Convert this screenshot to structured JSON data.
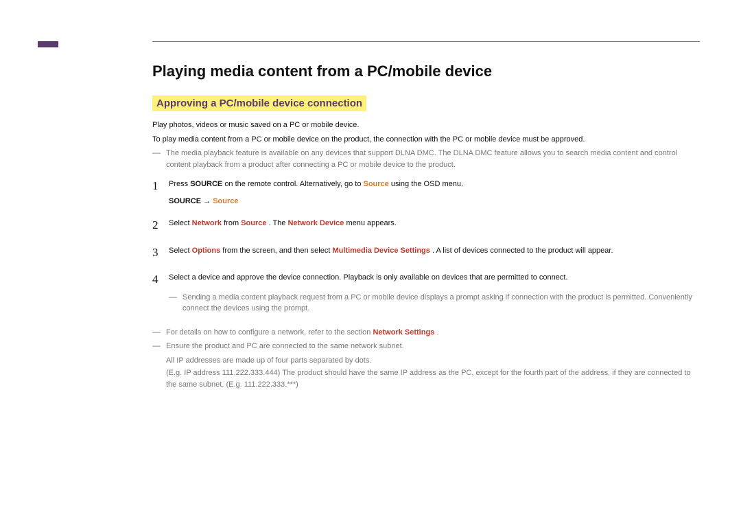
{
  "title": "Playing media content from a PC/mobile device",
  "section_heading": "Approving a PC/mobile device connection",
  "intro": {
    "line1": "Play photos, videos or music saved on a PC or mobile device.",
    "line2": "To play media content from a PC or mobile device on the product, the connection with the PC or mobile device must be approved.",
    "note": "The media playback feature is available on any devices that support DLNA DMC. The DLNA DMC feature allows you to search media content and control content playback from a product after connecting a PC or mobile device to the product."
  },
  "steps": [
    {
      "num": "1",
      "p1": "Press ",
      "b1": "SOURCE",
      "p2": " on the remote control. Alternatively, go to ",
      "o1": "Source",
      "p3": " using the OSD menu.",
      "path_a": "SOURCE",
      "arrow": " → ",
      "path_b": "Source"
    },
    {
      "num": "2",
      "p1": "Select ",
      "r1": "Network",
      "p2": " from ",
      "r2": "Source",
      "p3": ". The ",
      "r3": "Network Device",
      "p4": " menu appears."
    },
    {
      "num": "3",
      "p1": "Select ",
      "r1": "Options",
      "p2": " from the screen, and then select ",
      "r2": "Multimedia Device Settings",
      "p3": ". A list of devices connected to the product will appear."
    },
    {
      "num": "4",
      "p1": "Select a device and approve the device connection. Playback is only available on devices that are permitted to connect.",
      "note": "Sending a media content playback request from a PC or mobile device displays a prompt asking if connection with the product is permitted. Conveniently connect the devices using the prompt."
    }
  ],
  "footer": {
    "n1a": "For details on how to configure a network, refer to the section ",
    "n1b": "Network Settings",
    "n1c": ".",
    "n2": "Ensure the product and PC are connected to the same network subnet.",
    "sub1": "All IP addresses are made up of four parts separated by dots.",
    "sub2": "(E.g. IP address 111.222.333.444) The product should have the same IP address as the PC, except for the fourth part of the address, if they are connected to the same subnet. (E.g. 111.222.333.***)"
  }
}
